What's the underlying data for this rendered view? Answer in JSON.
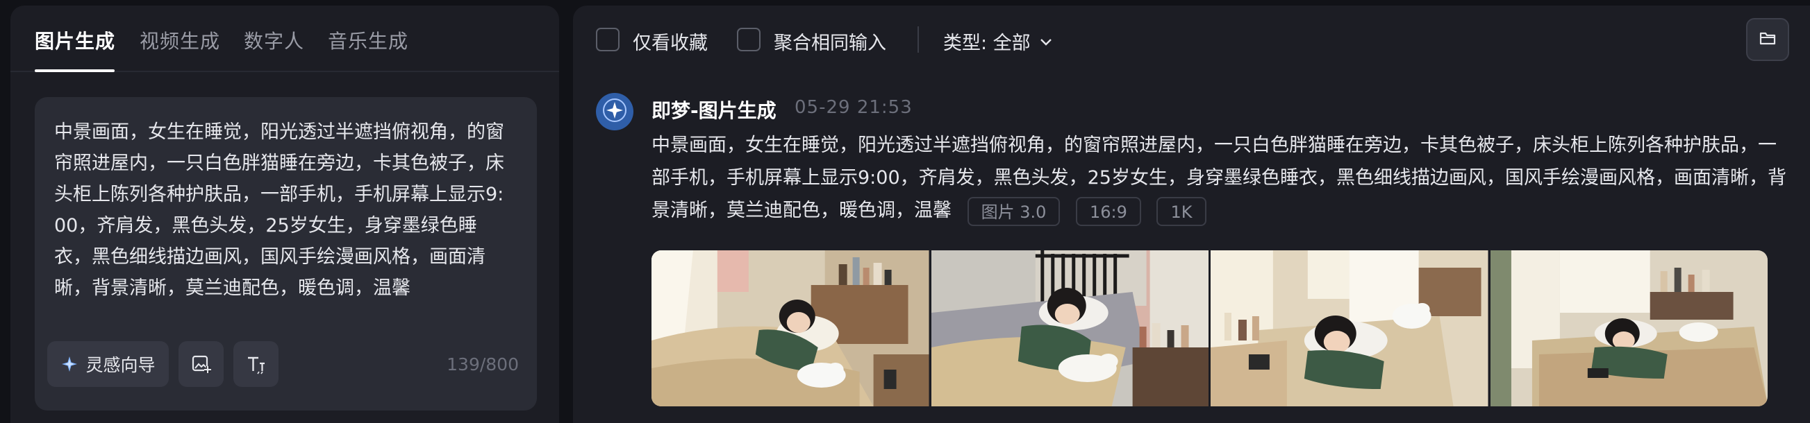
{
  "tabs": [
    {
      "label": "图片生成",
      "active": true
    },
    {
      "label": "视频生成"
    },
    {
      "label": "数字人"
    },
    {
      "label": "音乐生成"
    }
  ],
  "prompt_input": {
    "text": "中景画面，女生在睡觉，阳光透过半遮挡俯视角，的窗帘照进屋内，一只白色胖猫睡在旁边，卡其色被子，床头柜上陈列各种护肤品，一部手机，手机屏幕上显示9:00，齐肩发，黑色头发，25岁女生，身穿墨绿色睡衣，黑色细线描边画风，国风手绘漫画风格，画面清晰，背景清晰，莫兰迪配色，暖色调，温馨",
    "inspiration_label": "灵感向导",
    "counter": "139/800"
  },
  "filters": {
    "favorites_label": "仅看收藏",
    "merge_label": "聚合相同输入",
    "type_label": "类型: 全部"
  },
  "generation": {
    "title": "即梦-图片生成",
    "date": "05-29  21:53",
    "prompt": "中景画面，女生在睡觉，阳光透过半遮挡俯视角，的窗帘照进屋内，一只白色胖猫睡在旁边，卡其色被子，床头柜上陈列各种护肤品，一部手机，手机屏幕上显示9:00，齐肩发，黑色头发，25岁女生，身穿墨绿色睡衣，黑色细线描边画风，国风手绘漫画风格，画面清晰，背景清晰，莫兰迪配色，暖色调，温馨",
    "tags": [
      "图片 3.0",
      "16:9",
      "1K"
    ],
    "images": [
      "generated-image-1",
      "generated-image-2",
      "generated-image-3",
      "generated-image-4"
    ]
  },
  "colors": {
    "background": "#111217",
    "panel": "#1c1d24",
    "card": "#2a2c35",
    "accent_avatar": "#2f5ea8"
  }
}
